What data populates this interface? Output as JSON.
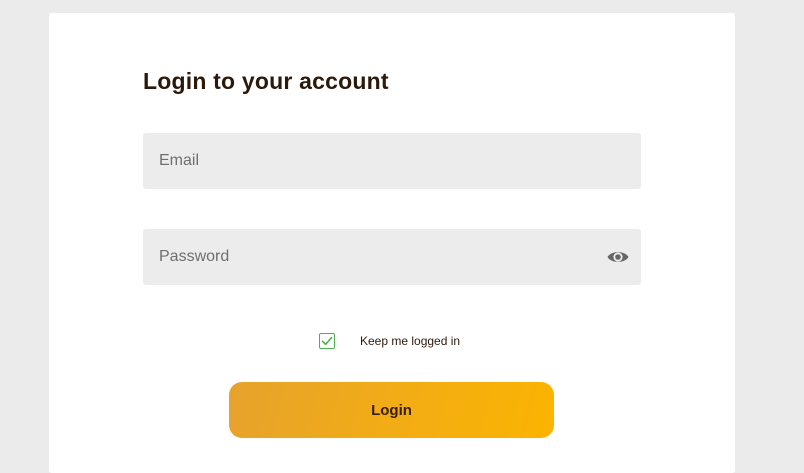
{
  "login_form": {
    "title": "Login to your account",
    "email": {
      "value": "",
      "placeholder": "Email"
    },
    "password": {
      "value": "",
      "placeholder": "Password",
      "toggle_icon": "eye-icon"
    },
    "remember_me": {
      "label": "Keep me logged in",
      "checked": true,
      "icon": "checkmark-icon"
    },
    "submit_label": "Login"
  },
  "colors": {
    "page_background": "#ebebeb",
    "card_background": "#ffffff",
    "field_background": "#ececec",
    "title_text": "#2b1a0c",
    "checkbox_accent": "#4caf50",
    "button_gradient_start": "#e6a22d",
    "button_gradient_end": "#fbb400",
    "button_text": "#3a1e05"
  }
}
